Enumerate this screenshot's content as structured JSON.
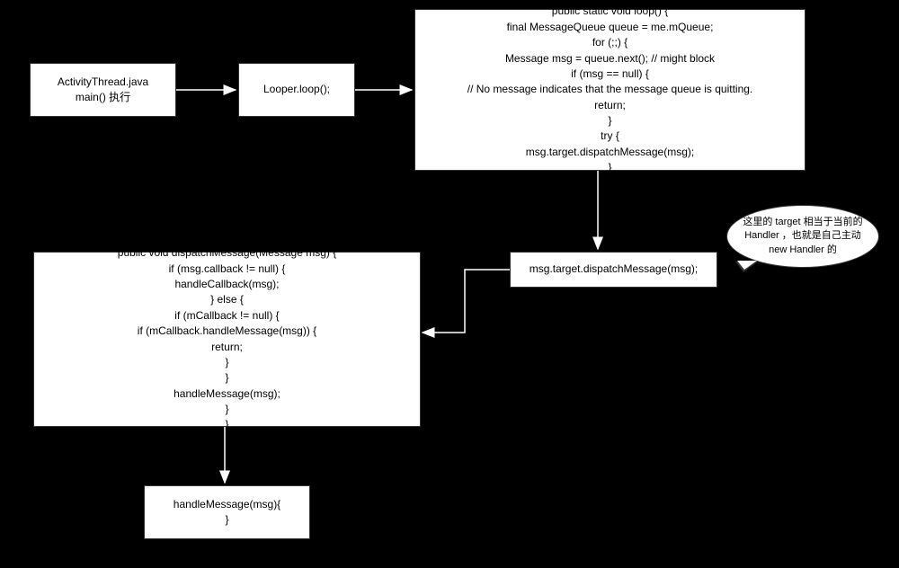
{
  "diagram": {
    "nodes": {
      "n1": "ActivityThread.java\nmain() 执行",
      "n2": "Looper.loop();",
      "n3": "public static void loop() {\nfinal MessageQueue queue = me.mQueue;\nfor (;;) {\nMessage msg = queue.next(); // might block\nif (msg == null) {\n// No message indicates that the message queue is quitting.\nreturn;\n}\ntry {\nmsg.target.dispatchMessage(msg);\n}",
      "n4": "msg.target.dispatchMessage(msg);",
      "n5": "public void dispatchMessage(Message msg) {\nif (msg.callback != null) {\nhandleCallback(msg);\n} else {\nif (mCallback != null) {\nif (mCallback.handleMessage(msg)) {\nreturn;\n}\n}\nhandleMessage(msg);\n}\n}",
      "n6": "handleMessage(msg){\n}"
    },
    "callout": "这里的 target 相当于当前的 Handler ，也就是自己主动 new Handler 的",
    "edges": [
      [
        "n1",
        "n2"
      ],
      [
        "n2",
        "n3"
      ],
      [
        "n3",
        "n4"
      ],
      [
        "n4",
        "n5"
      ],
      [
        "n5",
        "n6"
      ]
    ]
  }
}
